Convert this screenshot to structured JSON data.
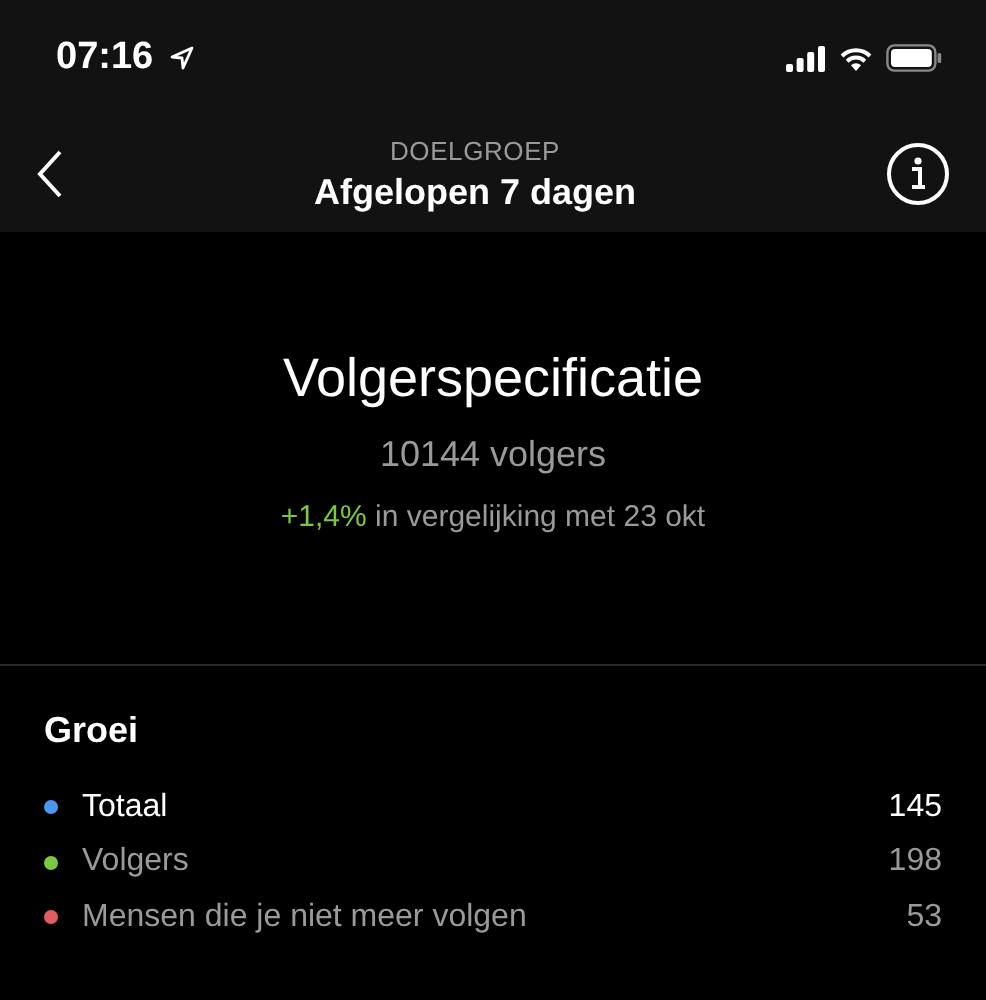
{
  "status_bar": {
    "time": "07:16"
  },
  "nav": {
    "overline": "DOELGROEP",
    "title": "Afgelopen 7 dagen"
  },
  "summary": {
    "title": "Volgerspecificatie",
    "count": "10144 volgers",
    "change": "+1,4%",
    "comparison": "in vergelijking met 23 okt"
  },
  "growth": {
    "title": "Groei",
    "items": [
      {
        "label": "Totaal",
        "value": "145",
        "color": "#4a96f0",
        "selected": true
      },
      {
        "label": "Volgers",
        "value": "198",
        "color": "#7bc843",
        "selected": false
      },
      {
        "label": "Mensen die je niet meer volgen",
        "value": "53",
        "color": "#e25c62",
        "selected": false
      }
    ]
  }
}
